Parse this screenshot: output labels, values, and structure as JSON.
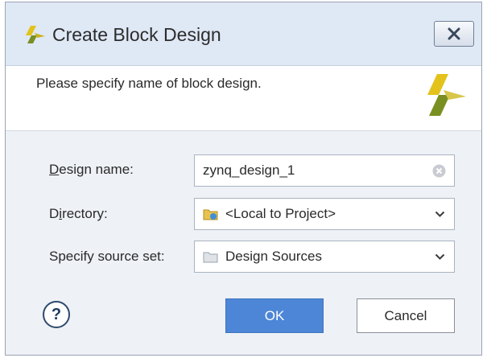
{
  "window": {
    "title": "Create Block Design",
    "close_glyph": "✕"
  },
  "header": {
    "description": "Please specify name of block design."
  },
  "form": {
    "design_name": {
      "label_mnemonic": "D",
      "label_rest": "esign name:",
      "value": "zynq_design_1"
    },
    "directory": {
      "label_start": "D",
      "label_mnemonic": "i",
      "label_rest": "rectory:",
      "value": "<Local to Project>",
      "icon": "folder-link-icon"
    },
    "source_set": {
      "label": "Specify source set:",
      "value": "Design Sources",
      "icon": "folder-icon"
    }
  },
  "buttons": {
    "help": "?",
    "ok": "OK",
    "cancel": "Cancel"
  },
  "colors": {
    "titlebar": "#dfe8f5",
    "ok_button": "#4d86d6",
    "logo_yellow": "#e3c21c",
    "logo_green": "#7a8f21"
  }
}
